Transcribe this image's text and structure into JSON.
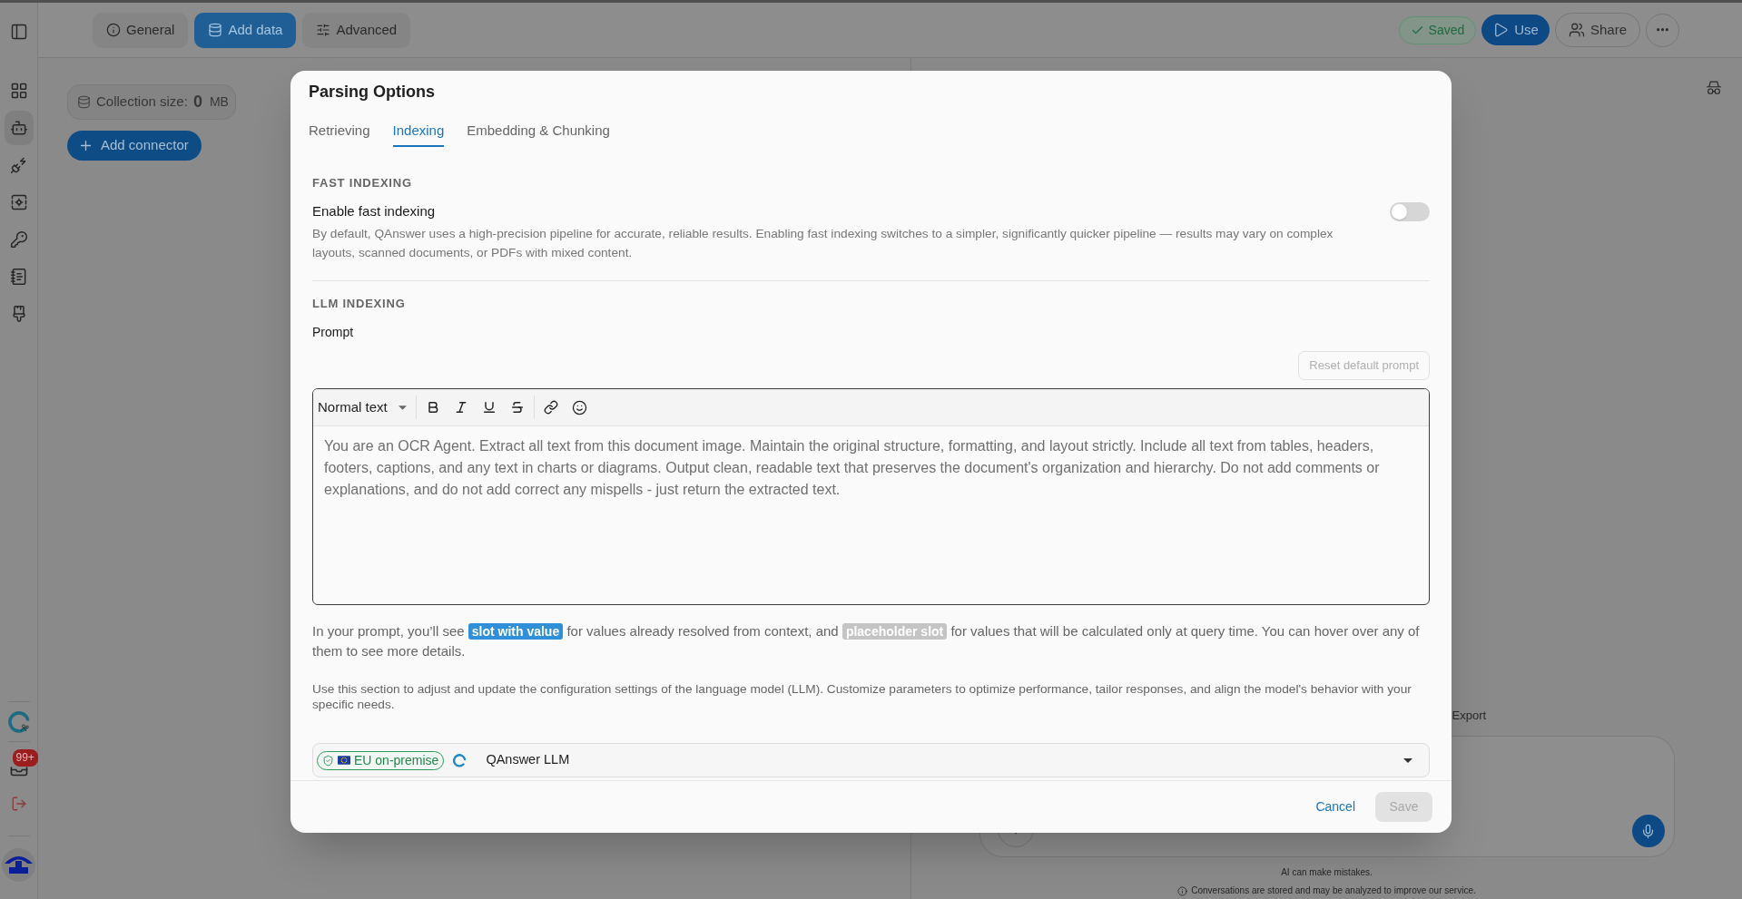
{
  "sidebar": {
    "nav_items": [
      {
        "selected": false
      },
      {
        "selected": true
      },
      {
        "selected": false
      },
      {
        "selected": false
      },
      {
        "selected": false
      },
      {
        "selected": false
      },
      {
        "selected": false
      }
    ],
    "notification_badge": "99+"
  },
  "top_bar": {
    "tabs": [
      {
        "label": "General",
        "selected": false
      },
      {
        "label": "Add data",
        "selected": true
      },
      {
        "label": "Advanced",
        "selected": false
      }
    ],
    "status": "Saved",
    "actions": [
      {
        "label": "Use",
        "kind": "primary"
      },
      {
        "label": "Share",
        "kind": "outline"
      }
    ]
  },
  "collection": {
    "label": "Collection size:",
    "value": "0",
    "unit": "MB"
  },
  "add_connector": "Add connector",
  "chat": {
    "export": "Export",
    "disclaimer": "AI can make mistakes.",
    "privacy_note": "Conversations are stored and may be analyzed to improve our service."
  },
  "dialog": {
    "title": "Parsing Options",
    "tabs": [
      {
        "label": "Retrieving",
        "selected": false
      },
      {
        "label": "Indexing",
        "selected": true
      },
      {
        "label": "Embedding & Chunking",
        "selected": false
      }
    ],
    "fast_indexing": {
      "heading": "FAST INDEXING",
      "label": "Enable fast indexing",
      "description": "By default, QAnswer uses a high-precision pipeline for accurate, reliable results. Enabling fast indexing switches to a simpler, significantly quicker pipeline — results may vary on complex layouts, scanned documents, or PDFs with mixed content.",
      "on": false
    },
    "llm_indexing": {
      "heading": "LLM INDEXING",
      "prompt_label": "Prompt",
      "reset_button": {
        "label": "Reset default prompt",
        "disabled": true
      },
      "editor": {
        "text_style": "Normal text",
        "value": "You are an OCR Agent. Extract all text from this document image. Maintain the original structure, formatting, and layout strictly. Include all text from tables, headers, footers, captions, and any text in charts or diagrams. Output clean, readable text that preserves the document's organization and hierarchy. Do not add comments or explanations, and do not add correct any mispells - just return the extracted text."
      },
      "slot_note": [
        {
          "kind": "text",
          "text": "In your prompt, you’ll see "
        },
        {
          "kind": "slot_value",
          "text": "slot with value"
        },
        {
          "kind": "text",
          "text": " for values already resolved from context, and "
        },
        {
          "kind": "slot_placeholder",
          "text": "placeholder slot"
        },
        {
          "kind": "text",
          "text": " for values that will be calculated only at query time. You can hover over any of them to see more details."
        }
      ],
      "config_note": "Use this section to adjust and update the configuration settings of the language model (LLM). Customize parameters to optimize performance, tailor responses, and align the model's behavior with your specific needs.",
      "model": {
        "badge": "EU on-premise",
        "name": "QAnswer LLM"
      }
    },
    "cancel": "Cancel",
    "save": {
      "label": "Save",
      "disabled": true
    }
  }
}
